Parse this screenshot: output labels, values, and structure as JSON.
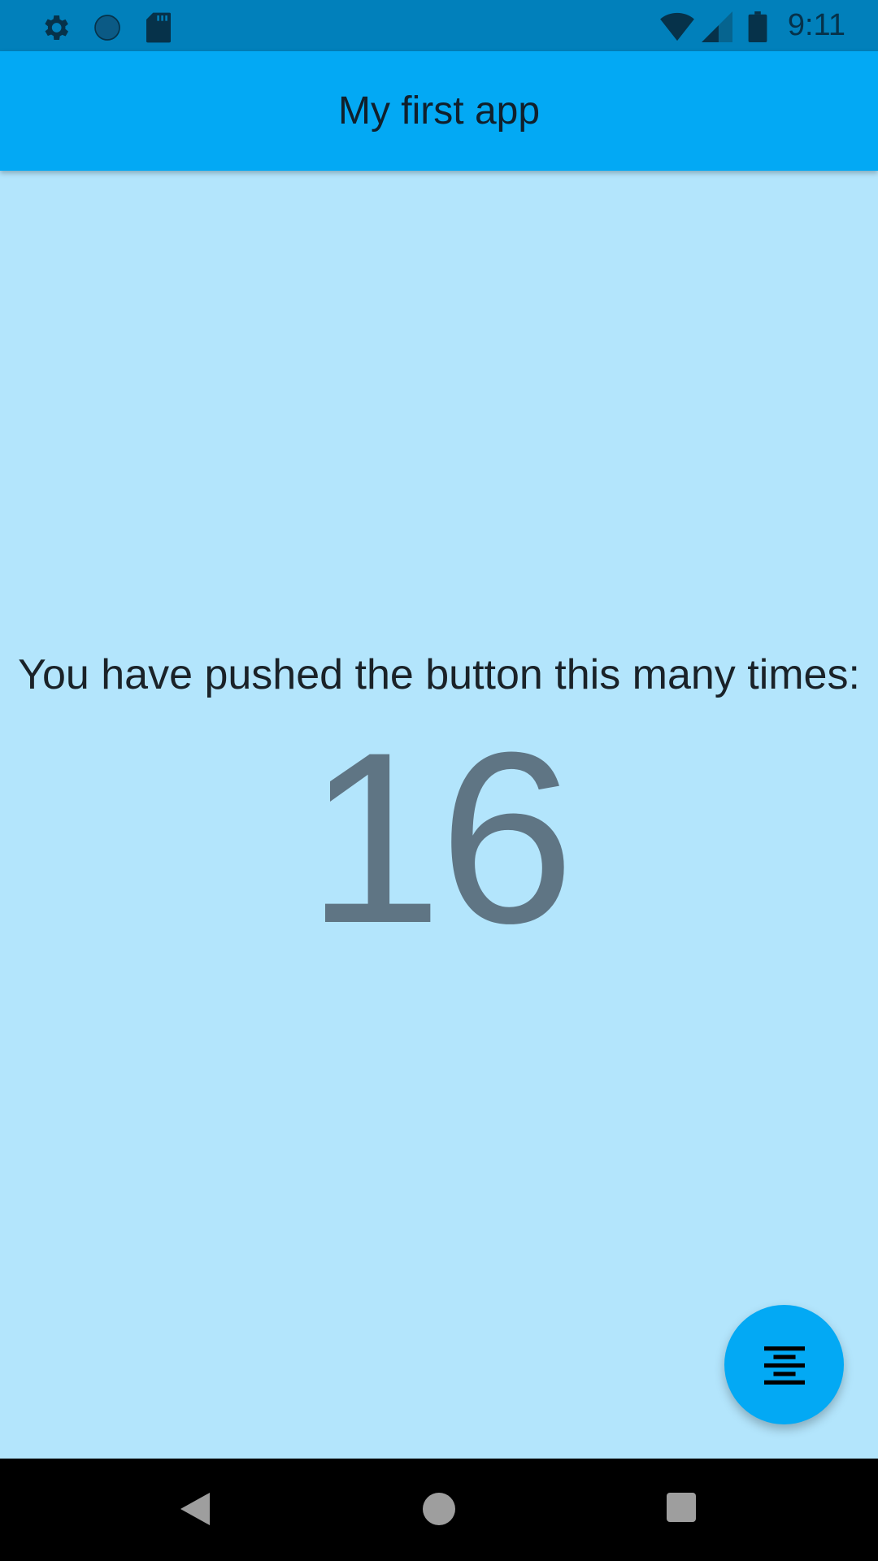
{
  "status_bar": {
    "time": "9:11",
    "icons": [
      "gear-icon",
      "sync-icon",
      "sd-card-icon",
      "wifi-icon",
      "signal-icon",
      "battery-icon"
    ]
  },
  "app_bar": {
    "title": "My first app"
  },
  "main": {
    "message": "You have pushed the button this many times:",
    "counter": "16"
  },
  "fab": {
    "icon": "format-align-center-icon"
  },
  "nav_bar": {
    "icons": [
      "back-icon",
      "home-icon",
      "recents-icon"
    ]
  },
  "colors": {
    "status_bar": "#0180bb",
    "app_bar": "#03a9f4",
    "background": "#b3e5fc",
    "fab": "#03a9f4",
    "counter": "#5f7584"
  }
}
